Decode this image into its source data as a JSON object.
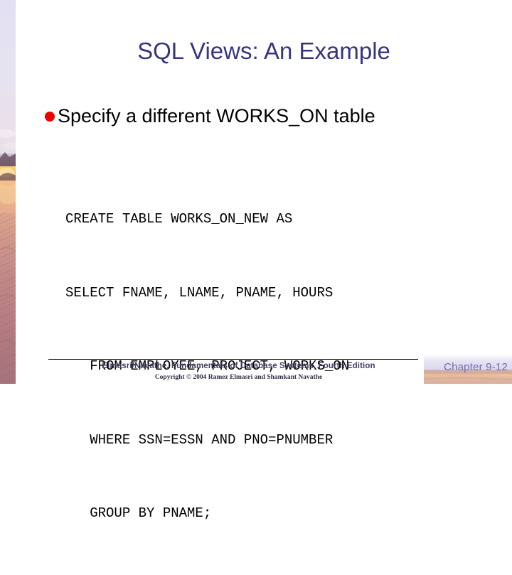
{
  "slide": {
    "title": "SQL Views: An Example",
    "bullets": [
      {
        "marker": "filled-circle-bullet",
        "text": "Specify a different WORKS_ON table"
      }
    ],
    "code": {
      "language": "sql",
      "lines": [
        "CREATE TABLE WORKS_ON_NEW AS",
        "SELECT FNAME, LNAME, PNAME, HOURS",
        "   FROM EMPLOYEE, PROJECT, WORKS_ON",
        "   WHERE SSN=ESSN AND PNO=PNUMBER",
        "   GROUP BY PNAME;"
      ]
    }
  },
  "footer": {
    "credit": "Elmasri/Navathe, Fundamentals of Database Systems, Fourth Edition",
    "copyright": "Copyright © 2004 Ramez Elmasri and Shamkant Navathe",
    "chapter": "Chapter 9-12"
  },
  "colors": {
    "title": "#36357f",
    "bullet_marker": "#ee0000",
    "body_text": "#000000",
    "footer_text": "#3f4060",
    "chapter_text": "#6b6bb5",
    "background": "#ffffff",
    "rule": "#000000"
  }
}
